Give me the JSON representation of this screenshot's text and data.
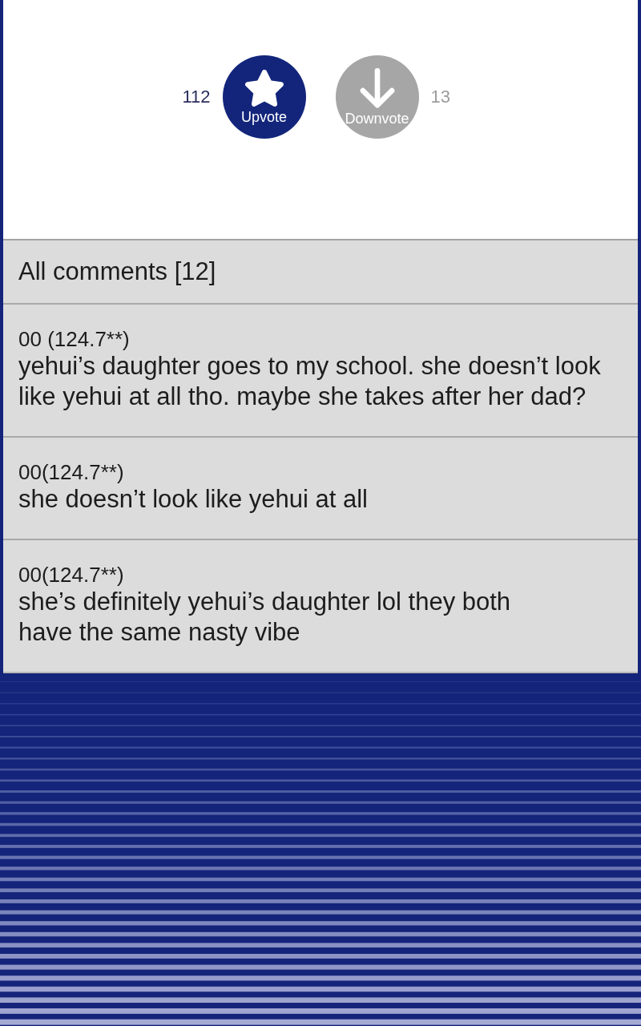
{
  "votes": [
    {
      "kind": "upvote",
      "label": "Upvote",
      "count": "112",
      "selected": true
    },
    {
      "kind": "downvote",
      "label": "Downvote",
      "count": "13",
      "selected": false
    }
  ],
  "comments_section": {
    "header": "All comments [12]",
    "comments": [
      {
        "author": "00 (124.7**)",
        "text": "yehui’s daughter goes to my school. she doesn’t look\nlike yehui at all tho. maybe she takes after her dad?"
      },
      {
        "author": "00(124.7**)",
        "text": "she doesn’t look like yehui at all"
      },
      {
        "author": "00(124.7**)",
        "text": "she’s definitely yehui’s daughter lol they both\nhave the same nasty vibe"
      }
    ]
  }
}
